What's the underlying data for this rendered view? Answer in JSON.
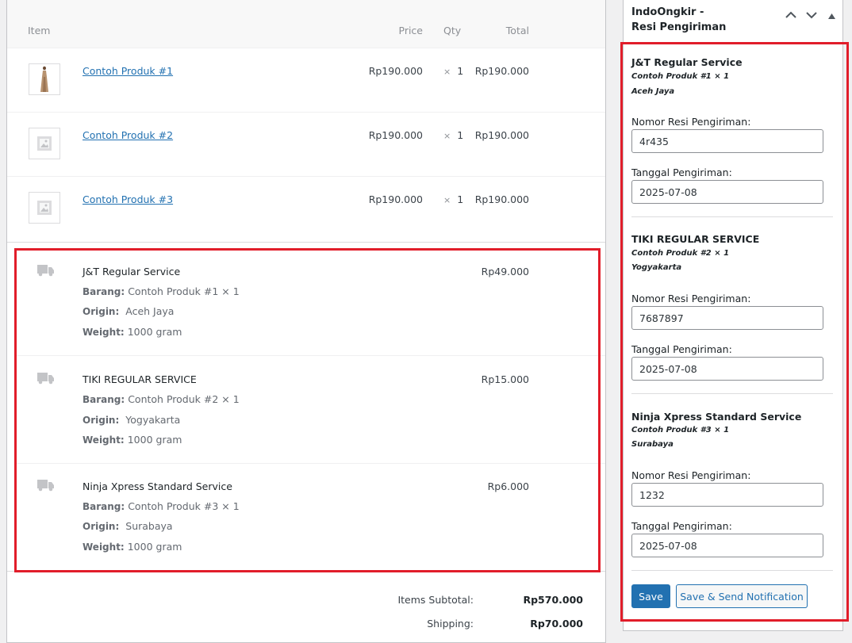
{
  "table": {
    "headers": {
      "item": "Item",
      "price": "Price",
      "qty": "Qty",
      "total": "Total"
    },
    "items": [
      {
        "name": "Contoh Produk #1",
        "price": "Rp190.000",
        "qty_symbol": "×",
        "qty": "1",
        "total": "Rp190.000",
        "thumb": "dress-photo"
      },
      {
        "name": "Contoh Produk #2",
        "price": "Rp190.000",
        "qty_symbol": "×",
        "qty": "1",
        "total": "Rp190.000",
        "thumb": "placeholder-image-icon"
      },
      {
        "name": "Contoh Produk #3",
        "price": "Rp190.000",
        "qty_symbol": "×",
        "qty": "1",
        "total": "Rp190.000",
        "thumb": "placeholder-image-icon"
      }
    ]
  },
  "shipping_lines": [
    {
      "name": "J&T Regular Service",
      "cost": "Rp49.000",
      "barang_label": "Barang:",
      "barang": "Contoh Produk #1 × 1",
      "origin_label": "Origin:",
      "origin": "Aceh Jaya",
      "weight_label": "Weight:",
      "weight": "1000 gram"
    },
    {
      "name": "TIKI REGULAR SERVICE",
      "cost": "Rp15.000",
      "barang_label": "Barang:",
      "barang": "Contoh Produk #2 × 1",
      "origin_label": "Origin:",
      "origin": "Yogyakarta",
      "weight_label": "Weight:",
      "weight": "1000 gram"
    },
    {
      "name": "Ninja Xpress Standard Service",
      "cost": "Rp6.000",
      "barang_label": "Barang:",
      "barang": "Contoh Produk #3 × 1",
      "origin_label": "Origin:",
      "origin": "Surabaya",
      "weight_label": "Weight:",
      "weight": "1000 gram"
    }
  ],
  "totals": {
    "subtotal_label": "Items Subtotal:",
    "subtotal": "Rp570.000",
    "shipping_label": "Shipping:",
    "shipping": "Rp70.000"
  },
  "metabox": {
    "title_line1": "IndoOngkir -",
    "title_line2": "Resi Pengiriman",
    "services": [
      {
        "name": "J&T Regular Service",
        "product": "Contoh Produk #1 × 1",
        "city": "Aceh Jaya",
        "resi_label": "Nomor Resi Pengiriman:",
        "resi": "4r435",
        "date_label": "Tanggal Pengiriman:",
        "date": "2025-07-08"
      },
      {
        "name": "TIKI REGULAR SERVICE",
        "product": "Contoh Produk #2 × 1",
        "city": "Yogyakarta",
        "resi_label": "Nomor Resi Pengiriman:",
        "resi": "7687897",
        "date_label": "Tanggal Pengiriman:",
        "date": "2025-07-08"
      },
      {
        "name": "Ninja Xpress Standard Service",
        "product": "Contoh Produk #3 × 1",
        "city": "Surabaya",
        "resi_label": "Nomor Resi Pengiriman:",
        "resi": "1232",
        "date_label": "Tanggal Pengiriman:",
        "date": "2025-07-08"
      }
    ],
    "save_label": "Save",
    "send_label": "Save & Send Notification"
  },
  "colors": {
    "accent": "#2271b1",
    "highlight": "#e11d2a",
    "border": "#c3c4c7"
  }
}
